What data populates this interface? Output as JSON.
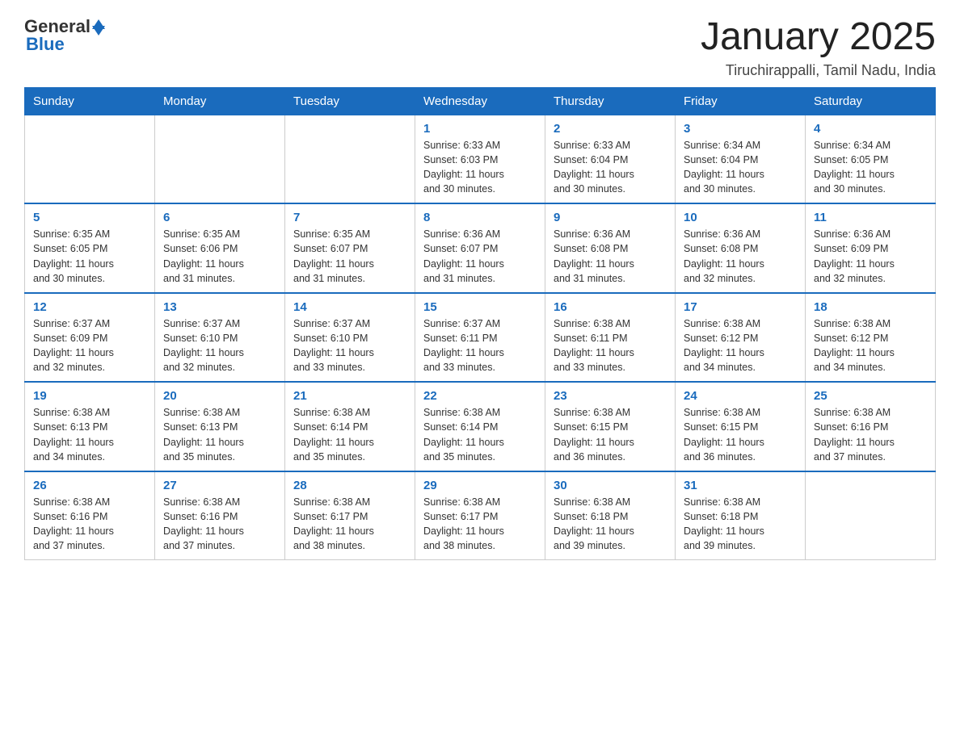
{
  "header": {
    "logo": {
      "general": "General",
      "blue": "Blue"
    },
    "title": "January 2025",
    "subtitle": "Tiruchirappalli, Tamil Nadu, India"
  },
  "calendar": {
    "days_of_week": [
      "Sunday",
      "Monday",
      "Tuesday",
      "Wednesday",
      "Thursday",
      "Friday",
      "Saturday"
    ],
    "weeks": [
      [
        {
          "day": "",
          "info": ""
        },
        {
          "day": "",
          "info": ""
        },
        {
          "day": "",
          "info": ""
        },
        {
          "day": "1",
          "info": "Sunrise: 6:33 AM\nSunset: 6:03 PM\nDaylight: 11 hours\nand 30 minutes."
        },
        {
          "day": "2",
          "info": "Sunrise: 6:33 AM\nSunset: 6:04 PM\nDaylight: 11 hours\nand 30 minutes."
        },
        {
          "day": "3",
          "info": "Sunrise: 6:34 AM\nSunset: 6:04 PM\nDaylight: 11 hours\nand 30 minutes."
        },
        {
          "day": "4",
          "info": "Sunrise: 6:34 AM\nSunset: 6:05 PM\nDaylight: 11 hours\nand 30 minutes."
        }
      ],
      [
        {
          "day": "5",
          "info": "Sunrise: 6:35 AM\nSunset: 6:05 PM\nDaylight: 11 hours\nand 30 minutes."
        },
        {
          "day": "6",
          "info": "Sunrise: 6:35 AM\nSunset: 6:06 PM\nDaylight: 11 hours\nand 31 minutes."
        },
        {
          "day": "7",
          "info": "Sunrise: 6:35 AM\nSunset: 6:07 PM\nDaylight: 11 hours\nand 31 minutes."
        },
        {
          "day": "8",
          "info": "Sunrise: 6:36 AM\nSunset: 6:07 PM\nDaylight: 11 hours\nand 31 minutes."
        },
        {
          "day": "9",
          "info": "Sunrise: 6:36 AM\nSunset: 6:08 PM\nDaylight: 11 hours\nand 31 minutes."
        },
        {
          "day": "10",
          "info": "Sunrise: 6:36 AM\nSunset: 6:08 PM\nDaylight: 11 hours\nand 32 minutes."
        },
        {
          "day": "11",
          "info": "Sunrise: 6:36 AM\nSunset: 6:09 PM\nDaylight: 11 hours\nand 32 minutes."
        }
      ],
      [
        {
          "day": "12",
          "info": "Sunrise: 6:37 AM\nSunset: 6:09 PM\nDaylight: 11 hours\nand 32 minutes."
        },
        {
          "day": "13",
          "info": "Sunrise: 6:37 AM\nSunset: 6:10 PM\nDaylight: 11 hours\nand 32 minutes."
        },
        {
          "day": "14",
          "info": "Sunrise: 6:37 AM\nSunset: 6:10 PM\nDaylight: 11 hours\nand 33 minutes."
        },
        {
          "day": "15",
          "info": "Sunrise: 6:37 AM\nSunset: 6:11 PM\nDaylight: 11 hours\nand 33 minutes."
        },
        {
          "day": "16",
          "info": "Sunrise: 6:38 AM\nSunset: 6:11 PM\nDaylight: 11 hours\nand 33 minutes."
        },
        {
          "day": "17",
          "info": "Sunrise: 6:38 AM\nSunset: 6:12 PM\nDaylight: 11 hours\nand 34 minutes."
        },
        {
          "day": "18",
          "info": "Sunrise: 6:38 AM\nSunset: 6:12 PM\nDaylight: 11 hours\nand 34 minutes."
        }
      ],
      [
        {
          "day": "19",
          "info": "Sunrise: 6:38 AM\nSunset: 6:13 PM\nDaylight: 11 hours\nand 34 minutes."
        },
        {
          "day": "20",
          "info": "Sunrise: 6:38 AM\nSunset: 6:13 PM\nDaylight: 11 hours\nand 35 minutes."
        },
        {
          "day": "21",
          "info": "Sunrise: 6:38 AM\nSunset: 6:14 PM\nDaylight: 11 hours\nand 35 minutes."
        },
        {
          "day": "22",
          "info": "Sunrise: 6:38 AM\nSunset: 6:14 PM\nDaylight: 11 hours\nand 35 minutes."
        },
        {
          "day": "23",
          "info": "Sunrise: 6:38 AM\nSunset: 6:15 PM\nDaylight: 11 hours\nand 36 minutes."
        },
        {
          "day": "24",
          "info": "Sunrise: 6:38 AM\nSunset: 6:15 PM\nDaylight: 11 hours\nand 36 minutes."
        },
        {
          "day": "25",
          "info": "Sunrise: 6:38 AM\nSunset: 6:16 PM\nDaylight: 11 hours\nand 37 minutes."
        }
      ],
      [
        {
          "day": "26",
          "info": "Sunrise: 6:38 AM\nSunset: 6:16 PM\nDaylight: 11 hours\nand 37 minutes."
        },
        {
          "day": "27",
          "info": "Sunrise: 6:38 AM\nSunset: 6:16 PM\nDaylight: 11 hours\nand 37 minutes."
        },
        {
          "day": "28",
          "info": "Sunrise: 6:38 AM\nSunset: 6:17 PM\nDaylight: 11 hours\nand 38 minutes."
        },
        {
          "day": "29",
          "info": "Sunrise: 6:38 AM\nSunset: 6:17 PM\nDaylight: 11 hours\nand 38 minutes."
        },
        {
          "day": "30",
          "info": "Sunrise: 6:38 AM\nSunset: 6:18 PM\nDaylight: 11 hours\nand 39 minutes."
        },
        {
          "day": "31",
          "info": "Sunrise: 6:38 AM\nSunset: 6:18 PM\nDaylight: 11 hours\nand 39 minutes."
        },
        {
          "day": "",
          "info": ""
        }
      ]
    ]
  }
}
